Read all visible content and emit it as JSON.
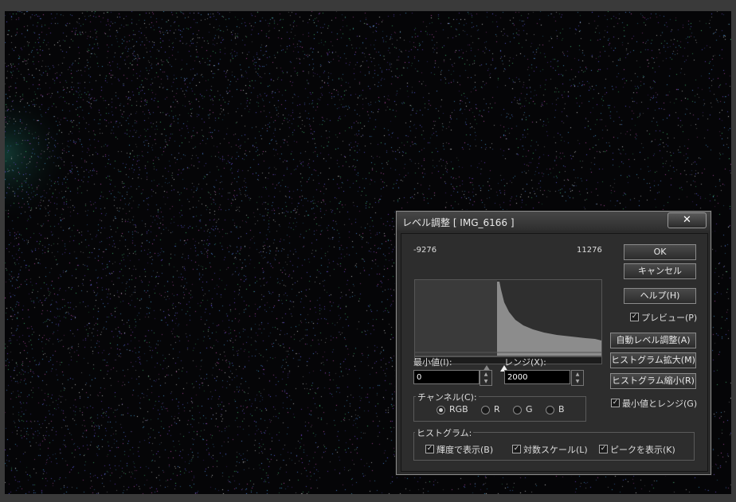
{
  "dialog": {
    "title": "レベル調整 [ IMG_6166 ]",
    "close_label": "✕",
    "hist_min_label": "-9276",
    "hist_max_label": "11276",
    "buttons": {
      "ok": "OK",
      "cancel": "キャンセル",
      "help": "ヘルプ(H)",
      "auto_level": "自動レベル調整(A)",
      "zoom_in": "ヒストグラム拡大(M)",
      "zoom_out": "ヒストグラム縮小(R)"
    },
    "preview": {
      "label": "プレビュー(P)",
      "checked": true
    },
    "min_value": {
      "label": "最小値(I):",
      "value": "0"
    },
    "range": {
      "label": "レンジ(X):",
      "value": "2000"
    },
    "channel": {
      "title": "チャンネル(C):",
      "options": [
        "RGB",
        "R",
        "G",
        "B"
      ],
      "selected": "RGB"
    },
    "min_and_range": {
      "label": "最小値とレンジ(G)",
      "checked": true
    },
    "histogram": {
      "title": "ヒストグラム:",
      "options": [
        {
          "label": "輝度で表示(B)",
          "checked": true
        },
        {
          "label": "対数スケール(L)",
          "checked": true
        },
        {
          "label": "ピークを表示(K)",
          "checked": true
        }
      ]
    }
  }
}
